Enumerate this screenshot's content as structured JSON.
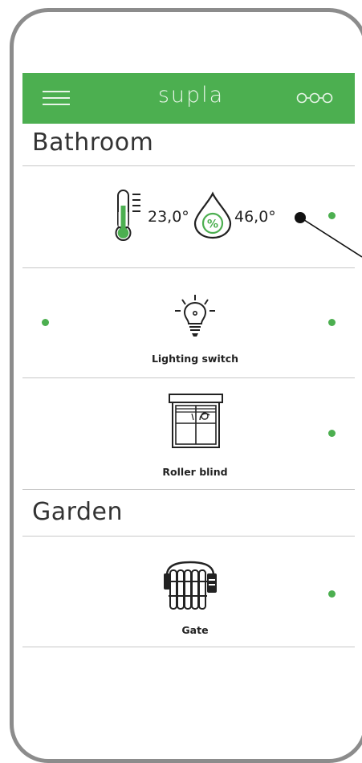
{
  "header": {
    "logo_text": "supla",
    "accent_color": "#4caf50",
    "menu_icon": "hamburger-menu-icon",
    "settings_icon": "triple-circle-icon"
  },
  "locations": [
    {
      "name": "Bathroom",
      "channels": [
        {
          "type": "thermometer-hygrometer",
          "temperature": "23,0°",
          "humidity": "46,0°",
          "icons": [
            "thermometer-icon",
            "humidity-drop-icon"
          ],
          "status": "online"
        },
        {
          "type": "light-switch",
          "label": "Lighting switch",
          "icon": "light-bulb-icon",
          "status": "online"
        },
        {
          "type": "roller-shutter",
          "label": "Roller blind",
          "icon": "roller-blind-icon",
          "status": "online"
        }
      ]
    },
    {
      "name": "Garden",
      "channels": [
        {
          "type": "gate",
          "label": "Gate",
          "icon": "gate-icon",
          "status": "online"
        }
      ]
    }
  ]
}
